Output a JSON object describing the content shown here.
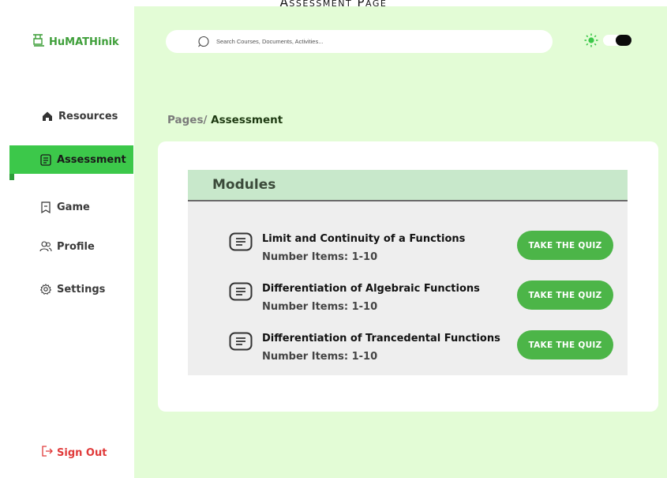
{
  "page_caption": "Assessment Page",
  "app": {
    "name": "HuMATHinik"
  },
  "search": {
    "placeholder": "Search Courses, Documents, Activities..."
  },
  "sidebar": {
    "items": [
      {
        "label": "Resources",
        "icon": "home-icon"
      },
      {
        "label": "Assessment",
        "icon": "document-icon",
        "active": true
      },
      {
        "label": "Game",
        "icon": "bookmark-icon"
      },
      {
        "label": "Profile",
        "icon": "users-icon"
      },
      {
        "label": "Settings",
        "icon": "gear-icon"
      }
    ],
    "signout_label": "Sign Out"
  },
  "breadcrumb": {
    "prefix": "Pages/",
    "current": "Assessment"
  },
  "modules": {
    "title": "Modules",
    "items": [
      {
        "title": "Limit and Continuity of a Functions",
        "items_text": "Number Items: 1-10",
        "button": "TAKE THE QUIZ"
      },
      {
        "title": "Differentiation of Algebraic Functions",
        "items_text": "Number Items: 1-10",
        "button": "TAKE THE QUIZ"
      },
      {
        "title": "Differentiation of Trancedental Functions",
        "items_text": "Number Items: 1-10",
        "button": "TAKE THE QUIZ"
      }
    ]
  },
  "colors": {
    "accent": "#3cc84a",
    "button": "#4cb548",
    "main_bg": "#e3fcd6",
    "header_bg": "#c8e8cb",
    "signout": "#e03a3a"
  }
}
